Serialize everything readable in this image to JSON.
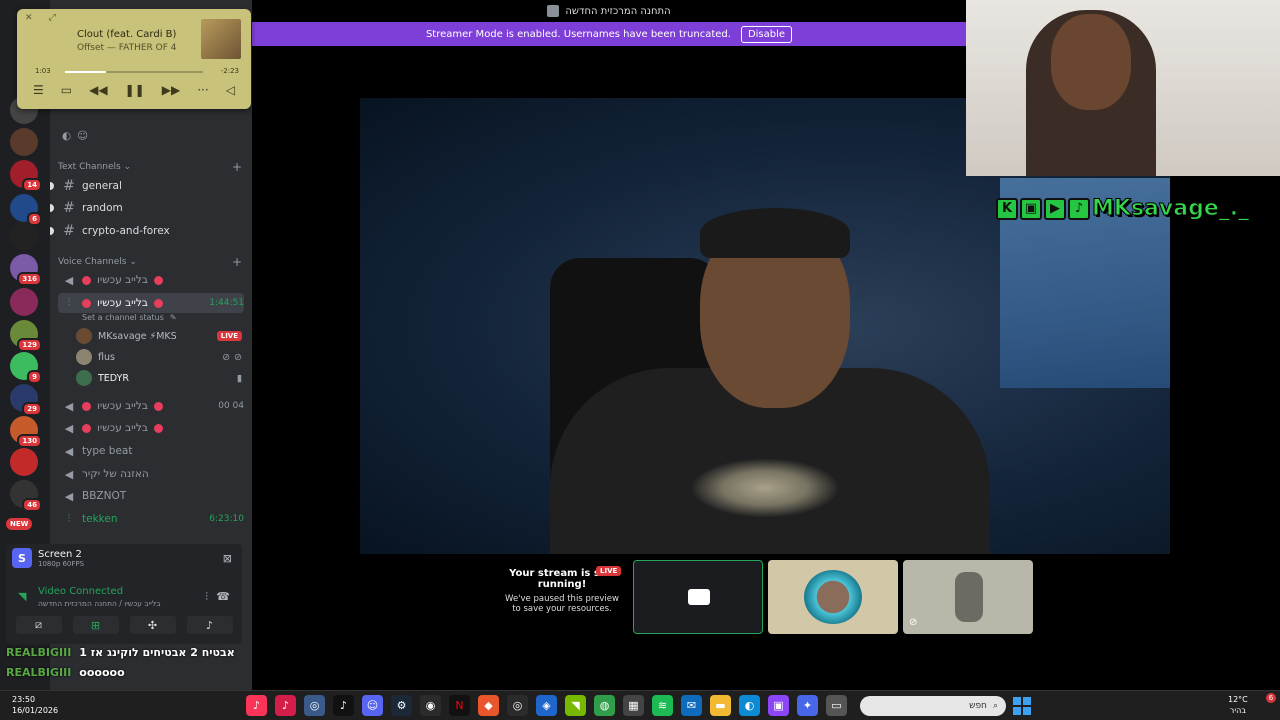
{
  "window": {
    "title": "התחנה המרכזית החדשה"
  },
  "streamer_banner": {
    "text": "Streamer Mode is enabled. Usernames have been truncated.",
    "button": "Disable",
    "color": "#7e3fd8"
  },
  "music_player": {
    "song": "Clout (feat. Cardi B)",
    "artist": "Offset — FATHER OF 4",
    "elapsed": "1:03",
    "remaining": "-2:23",
    "progress": 0.3,
    "icons": [
      "list-icon",
      "lyrics-icon",
      "rewind-icon",
      "pause-icon",
      "fast-forward-icon",
      "more-icon",
      "volume-icon"
    ]
  },
  "servers": [
    {
      "badge": "",
      "color": "#444"
    },
    {
      "badge": "",
      "color": "#5a3a2a"
    },
    {
      "badge": "14",
      "color": "#a01f2a"
    },
    {
      "badge": "6",
      "color": "#204a8a"
    },
    {
      "badge": "",
      "color": "#222"
    },
    {
      "badge": "316",
      "color": "#7b5aa8"
    },
    {
      "badge": "",
      "color": "#8a2a5a"
    },
    {
      "badge": "129",
      "color": "#6a8a3a"
    },
    {
      "badge": "9",
      "color": "#3dbb5f"
    },
    {
      "badge": "29",
      "color": "#2a3a6a"
    },
    {
      "badge": "130",
      "color": "#c65a2a"
    },
    {
      "badge": "",
      "color": "#c22a2a"
    },
    {
      "badge": "46",
      "color": "#333"
    }
  ],
  "new_badge": "NEW",
  "sidebar": {
    "text_category": "Text Channels",
    "text_channels": [
      "general",
      "random",
      "crypto-and-forex"
    ],
    "voice_category": "Voice Channels",
    "voice_channels": [
      {
        "name": "בלייב עכשיו",
        "right": ""
      },
      {
        "name": "בלייב עכשיו",
        "right": "1:44:51",
        "status": "Set a channel status"
      },
      {
        "name": "בלייב עכשיו",
        "right": "00  04"
      },
      {
        "name": "בלייב עכשיו",
        "right": ""
      },
      {
        "name": "type beat",
        "right": ""
      },
      {
        "name": "האזנה של יקיר",
        "right": ""
      },
      {
        "name": "BBZNOT",
        "right": ""
      },
      {
        "name": "tekken",
        "right": "6:23:10"
      }
    ],
    "users": [
      {
        "name": "MKsavage ⚡MKS",
        "live": "LIVE"
      },
      {
        "name": "flus",
        "live": ""
      },
      {
        "name": "TEDYR",
        "live": ""
      }
    ]
  },
  "screen_share": {
    "title": "Screen 2",
    "subtitle": "1080p 60FPS",
    "voice_status": "Video Connected",
    "voice_location": "בלייב עכשיו / התחנה המרכזית החדשה"
  },
  "chat": [
    {
      "name": "REALBIGIII",
      "msg": "אבטיח 2 אבטיחים לוקינג אז 1"
    },
    {
      "name": "REALBIGIII",
      "msg": "oooooo"
    }
  ],
  "overlay": {
    "handle": "MKsavage_._"
  },
  "stream_notice": {
    "title": "Your stream is still running!",
    "body": "We've paused this preview to save your resources.",
    "live": "LIVE"
  },
  "taskbar": {
    "time": "23:50",
    "date": "16/01/2026",
    "search_placeholder": "חפש",
    "temperature": "12°C",
    "weather_word": "בהיר",
    "notifications": "6"
  }
}
